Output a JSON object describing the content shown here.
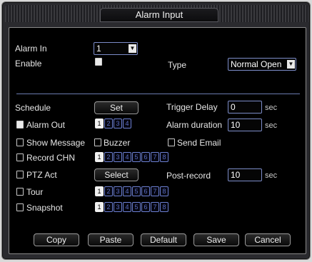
{
  "title": "Alarm Input",
  "alarm_in": {
    "label": "Alarm In",
    "value": "1"
  },
  "enable": {
    "label": "Enable",
    "checked": true
  },
  "type": {
    "label": "Type",
    "value": "Normal Open"
  },
  "schedule": {
    "label": "Schedule",
    "button": "Set"
  },
  "trigger_delay": {
    "label": "Trigger Delay",
    "value": "0",
    "unit": "sec"
  },
  "alarm_out": {
    "label": "Alarm Out",
    "channels": [
      "1",
      "2",
      "3",
      "4"
    ],
    "selected": [
      1
    ]
  },
  "alarm_duration": {
    "label": "Alarm duration",
    "value": "10",
    "unit": "sec"
  },
  "show_message": {
    "label": "Show Message"
  },
  "buzzer": {
    "label": "Buzzer"
  },
  "send_email": {
    "label": "Send Email"
  },
  "record_chn": {
    "label": "Record CHN",
    "channels": [
      "1",
      "2",
      "3",
      "4",
      "5",
      "6",
      "7",
      "8"
    ],
    "selected": [
      1
    ]
  },
  "ptz_act": {
    "label": "PTZ Act",
    "button": "Select"
  },
  "post_record": {
    "label": "Post-record",
    "value": "10",
    "unit": "sec"
  },
  "tour": {
    "label": "Tour",
    "channels": [
      "1",
      "2",
      "3",
      "4",
      "5",
      "6",
      "7",
      "8"
    ],
    "selected": [
      1
    ]
  },
  "snapshot": {
    "label": "Snapshot",
    "channels": [
      "1",
      "2",
      "3",
      "4",
      "5",
      "6",
      "7",
      "8"
    ],
    "selected": [
      1
    ]
  },
  "buttons": {
    "copy": "Copy",
    "paste": "Paste",
    "default": "Default",
    "save": "Save",
    "cancel": "Cancel"
  },
  "icons": {
    "dropdown": "chevron-down-icon"
  },
  "colors": {
    "accent": "#6b7fd0",
    "background": "#000000"
  }
}
